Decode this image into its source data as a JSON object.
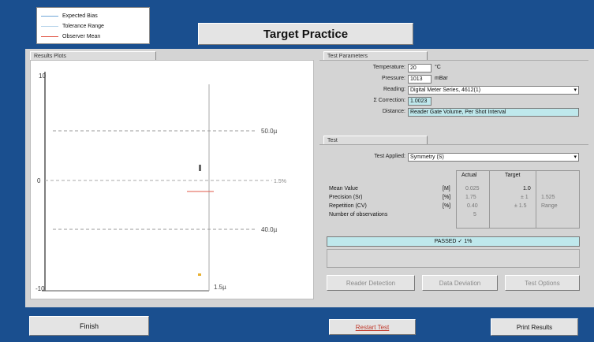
{
  "title": "Target Practice",
  "legend": {
    "items": [
      {
        "label": "Expected Bias",
        "color": "#6fa6d8"
      },
      {
        "label": "Tolerance Range",
        "color": "#b8d4ea"
      },
      {
        "label": "Observer Mean",
        "color": "#e25a4a"
      }
    ]
  },
  "results": {
    "tab": "Results Plots",
    "y_top": "10",
    "y_mid": "0",
    "y_bot": "-10",
    "upper_label": "50.0µ",
    "lower_label": "40.0µ",
    "right_tick": "1.5%",
    "x_label": "1.5µ",
    "colors": {
      "axis": "#555555",
      "tolerance": "#9a9a9a",
      "center": "#aaaaaa",
      "mean": "#e25a4a",
      "point": "#e8b030"
    }
  },
  "params": {
    "tab": "Test Parameters",
    "temperature_label": "Temperature:",
    "temperature_value": "20",
    "temperature_unit": "°C",
    "pressure_label": "Pressure:",
    "pressure_value": "1013",
    "pressure_unit": "mBar",
    "reading_label": "Reading:",
    "reading_value": "Digital Meter Series, 4612(1)",
    "correction_label": "Σ Correction:",
    "correction_value": "1.0023",
    "distance_label": "Distance:",
    "distance_value": "Reader Gate Volume, Per Shot Interval"
  },
  "test": {
    "tab": "Test",
    "applied_label": "Test Applied:",
    "applied_value": "Symmetry (S)",
    "col_actual": "Actual",
    "col_target": "Target",
    "rows": [
      {
        "label": "Mean Value",
        "unit": "[M]",
        "actual": "0.025",
        "target": "1.0",
        "extra": ""
      },
      {
        "label": "Precision (Sr)",
        "unit": "[%]",
        "actual": "1.75",
        "target": "± 1",
        "extra": "1.525"
      },
      {
        "label": "Repetition (CV)",
        "unit": "[%]",
        "actual": "0.40",
        "target": "± 1.5",
        "extra": "Range"
      },
      {
        "label": "Number of observations",
        "unit": "",
        "actual": "5",
        "target": "",
        "extra": ""
      }
    ],
    "result": "PASSED ✓ 1%",
    "btn_reader": "Reader Detection",
    "btn_data": "Data Deviation",
    "btn_test": "Test Options"
  },
  "footer": {
    "finish": "Finish",
    "restart": "Restart Test",
    "print": "Print Results"
  }
}
